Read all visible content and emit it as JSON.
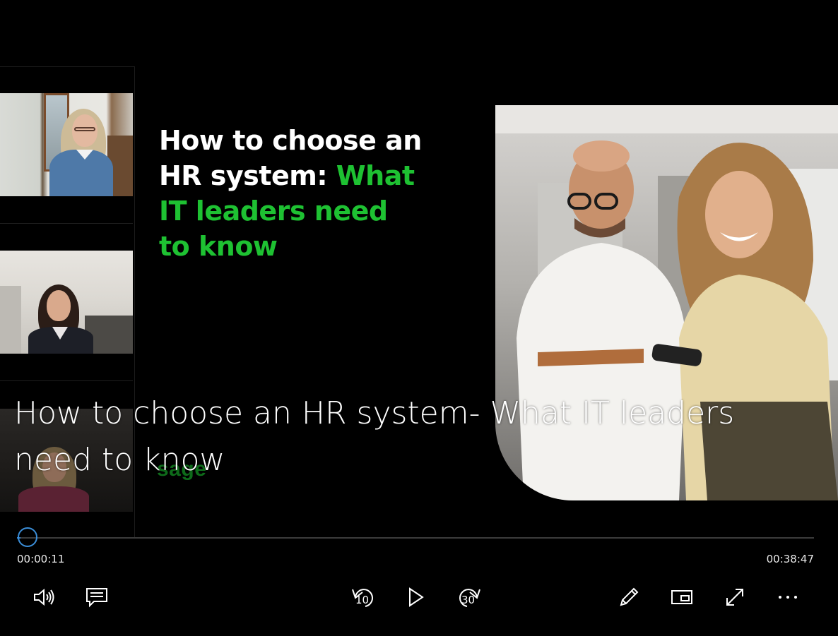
{
  "slide": {
    "title_line1": "How to choose an",
    "title_line2_white": "HR system: ",
    "title_line2_green": "What",
    "title_line3": "IT leaders need",
    "title_line4": "to know",
    "brand": "sage"
  },
  "caption": {
    "line1": "How to choose an HR system- What IT leaders",
    "line2": "need to know"
  },
  "player": {
    "progress_fraction": 0.0047,
    "current_time": "00:00:11",
    "total_time": "00:38:47",
    "skip_back_seconds": "10",
    "skip_forward_seconds": "30"
  },
  "icons": {
    "volume": "volume-icon",
    "captions": "captions-icon",
    "skip_back": "skip-back-10-icon",
    "play": "play-icon",
    "skip_forward": "skip-forward-30-icon",
    "pen": "pen-icon",
    "mini_view": "mini-view-icon",
    "fullscreen": "fullscreen-icon",
    "more": "more-icon"
  },
  "colors": {
    "background": "#000000",
    "title_green": "#1ec132",
    "accent_blue": "#3b8ed8"
  }
}
